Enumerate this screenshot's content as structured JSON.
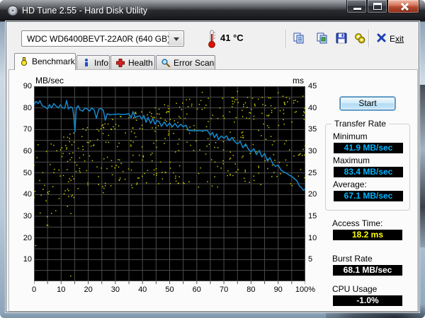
{
  "window": {
    "title": "HD Tune 2.55 - Hard Disk Utility",
    "caption_buttons": [
      "minimize",
      "maximize",
      "close"
    ]
  },
  "toolbar": {
    "drive_selector_value": "WDC WD6400BEVT-22A0R (640 GB)",
    "temperature": "41 °C",
    "buttons": [
      "copy-text",
      "copy-image",
      "save-screenshot",
      "options"
    ],
    "exit": {
      "prefix": "E",
      "accel": "xit"
    }
  },
  "tabs": {
    "active": "benchmark",
    "items": [
      {
        "id": "benchmark",
        "label": "Benchmark"
      },
      {
        "id": "info",
        "label": "Info"
      },
      {
        "id": "health",
        "label": "Health"
      },
      {
        "id": "error-scan",
        "label": "Error Scan"
      }
    ]
  },
  "panel": {
    "start_button": "Start",
    "transfer_rate": {
      "title": "Transfer Rate",
      "minimum_label": "Minimum",
      "minimum_value": "41.9 MB/sec",
      "maximum_label": "Maximum",
      "maximum_value": "83.4 MB/sec",
      "average_label": "Average:",
      "average_value": "67.1 MB/sec",
      "value_color": "#00b4ff"
    },
    "access_time_label": "Access Time:",
    "access_time_value": "18.2 ms",
    "access_time_color": "#ffff00",
    "burst_rate_label": "Burst Rate",
    "burst_rate_value": "68.1 MB/sec",
    "burst_rate_color": "#ffffff",
    "cpu_usage_label": "CPU Usage",
    "cpu_usage_value": "-1.0%",
    "cpu_usage_color": "#ffffff"
  },
  "chart_data": {
    "type": "line+scatter",
    "left_axis": {
      "label": "MB/sec",
      "min": 0,
      "max": 90,
      "ticks": [
        90,
        80,
        70,
        60,
        50,
        40,
        30,
        20,
        10
      ]
    },
    "right_axis": {
      "label": "ms",
      "min": 0,
      "max": 45,
      "ticks": [
        45,
        40,
        35,
        30,
        25,
        20,
        15,
        10,
        5
      ]
    },
    "x_axis": {
      "min": 0,
      "max": 100,
      "ticks": [
        "0",
        "10",
        "20",
        "30",
        "40",
        "50",
        "60",
        "70",
        "80",
        "90",
        "100%"
      ]
    },
    "grid": {
      "color": "#4b4b4b",
      "bg": "#000000",
      "x_step": 5,
      "y_step_left": 5
    },
    "series": [
      {
        "name": "transfer_rate",
        "type": "line",
        "axis": "left",
        "color": "#1589cd",
        "points": [
          [
            0,
            81.5
          ],
          [
            0.7,
            83
          ],
          [
            1.5,
            82
          ],
          [
            2.2,
            83.3
          ],
          [
            3,
            81
          ],
          [
            4,
            80.5
          ],
          [
            5,
            79.5
          ],
          [
            5.7,
            81.5
          ],
          [
            6.5,
            80
          ],
          [
            7.3,
            82
          ],
          [
            8,
            81
          ],
          [
            9,
            80
          ],
          [
            9.7,
            81.5
          ],
          [
            10.5,
            80
          ],
          [
            11.3,
            79.8
          ],
          [
            12,
            83.4
          ],
          [
            12.7,
            79.5
          ],
          [
            13.5,
            80.5
          ],
          [
            14.2,
            80
          ],
          [
            14.7,
            76
          ],
          [
            15.1,
            69
          ],
          [
            15.6,
            80
          ],
          [
            16.3,
            81
          ],
          [
            17,
            79
          ],
          [
            18,
            78.5
          ],
          [
            18.8,
            80
          ],
          [
            19.6,
            79.5
          ],
          [
            20.5,
            78.5
          ],
          [
            21.3,
            80
          ],
          [
            22.2,
            79
          ],
          [
            23,
            75.2
          ],
          [
            23.8,
            79.3
          ],
          [
            24.6,
            79.8
          ],
          [
            25.5,
            79
          ],
          [
            26.3,
            74.3
          ],
          [
            27,
            77.3
          ],
          [
            28,
            76.8
          ],
          [
            29,
            77
          ],
          [
            30,
            77
          ],
          [
            31,
            77.2
          ],
          [
            32,
            77
          ],
          [
            33,
            77
          ],
          [
            34,
            77.1
          ],
          [
            35,
            77.3
          ],
          [
            35.8,
            75.4
          ],
          [
            36.5,
            78.3
          ],
          [
            37.3,
            75.5
          ],
          [
            38,
            76
          ],
          [
            39,
            76.3
          ],
          [
            39.8,
            74.8
          ],
          [
            40.5,
            76.5
          ],
          [
            41.3,
            73.3
          ],
          [
            42,
            75.6
          ],
          [
            43,
            72.9
          ],
          [
            43.8,
            75
          ],
          [
            44.6,
            72.5
          ],
          [
            45.4,
            74.2
          ],
          [
            46.2,
            73.6
          ],
          [
            47,
            71.4
          ],
          [
            48,
            73.5
          ],
          [
            49,
            71.5
          ],
          [
            50,
            73
          ],
          [
            51,
            71.3
          ],
          [
            52,
            72.8
          ],
          [
            53,
            71
          ],
          [
            54,
            72.4
          ],
          [
            55,
            71.3
          ],
          [
            56,
            72
          ],
          [
            57,
            69.5
          ],
          [
            58,
            69.6
          ],
          [
            59,
            69.4
          ],
          [
            60,
            69.5
          ],
          [
            61,
            69.5
          ],
          [
            62,
            69.4
          ],
          [
            63,
            69.6
          ],
          [
            64,
            69.5
          ],
          [
            65,
            67.4
          ],
          [
            65.8,
            68.6
          ],
          [
            66.5,
            66.3
          ],
          [
            67.3,
            68
          ],
          [
            68,
            65.4
          ],
          [
            69,
            67
          ],
          [
            70,
            66
          ],
          [
            71,
            67.1
          ],
          [
            72,
            64.9
          ],
          [
            73,
            66.4
          ],
          [
            74,
            64.4
          ],
          [
            75,
            63.4
          ],
          [
            76,
            64.6
          ],
          [
            77,
            61.6
          ],
          [
            78,
            63.4
          ],
          [
            79,
            61
          ],
          [
            80,
            59.6
          ],
          [
            81,
            61.2
          ],
          [
            82,
            58.4
          ],
          [
            83,
            60.4
          ],
          [
            84,
            57.4
          ],
          [
            85,
            59
          ],
          [
            86,
            55.6
          ],
          [
            87,
            57
          ],
          [
            88,
            54.4
          ],
          [
            89,
            53
          ],
          [
            90,
            53.6
          ],
          [
            91,
            51.4
          ],
          [
            92,
            50.4
          ],
          [
            93,
            50
          ],
          [
            94,
            49
          ],
          [
            95,
            48.4
          ],
          [
            96,
            47.4
          ],
          [
            97,
            46.2
          ],
          [
            97.8,
            44
          ],
          [
            98.6,
            43.2
          ],
          [
            99.3,
            41.9
          ],
          [
            100,
            42.6
          ]
        ]
      },
      {
        "name": "access_time",
        "type": "scatter",
        "axis": "right",
        "color": "#c6c600",
        "approx": true,
        "n": 470,
        "seed": 9,
        "lower_envelope": [
          [
            0,
            6
          ],
          [
            10,
            13
          ],
          [
            20,
            19
          ],
          [
            30,
            21
          ],
          [
            100,
            22
          ]
        ],
        "upper_envelope": [
          [
            0,
            30
          ],
          [
            20,
            36
          ],
          [
            55,
            42
          ],
          [
            100,
            43
          ]
        ],
        "extra_points": [
          [
            13.5,
            1.2
          ],
          [
            62,
            43.6
          ],
          [
            75,
            43.8
          ],
          [
            90,
            43.5
          ],
          [
            1.5,
            31.5
          ],
          [
            12,
            30.5
          ]
        ]
      }
    ]
  }
}
